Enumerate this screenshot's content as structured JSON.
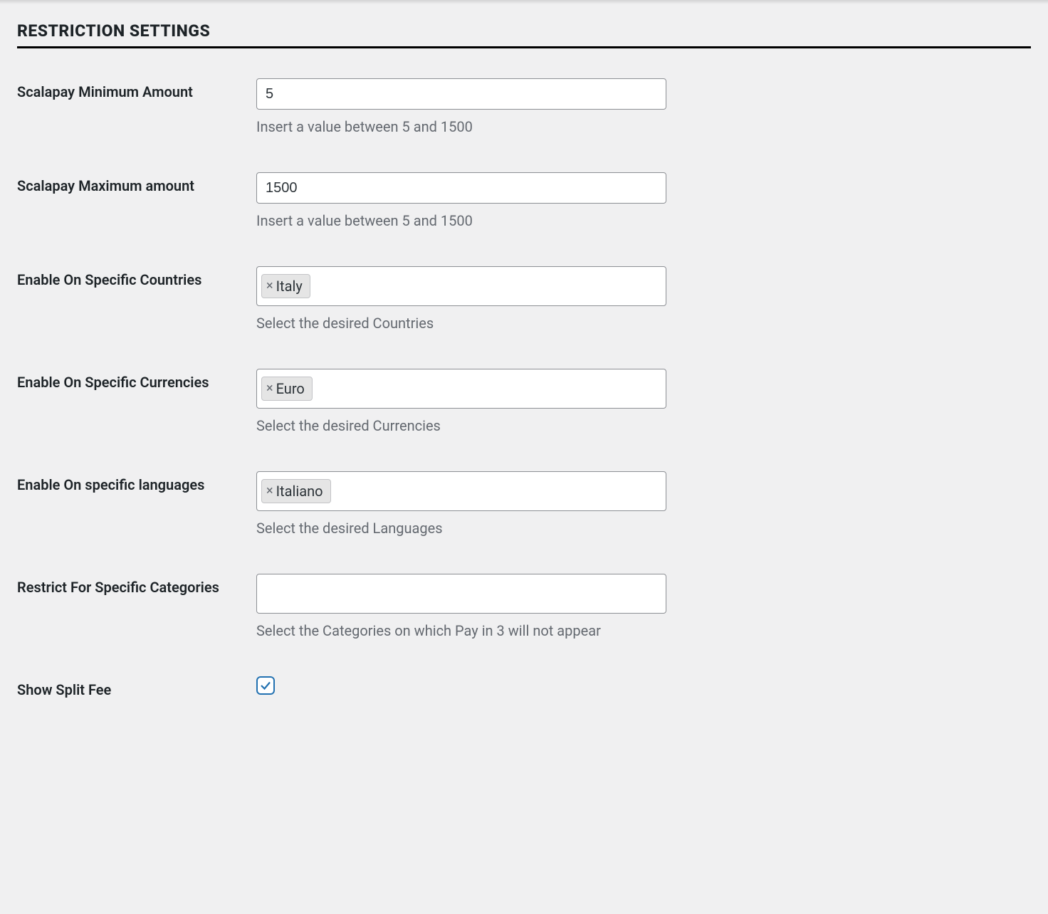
{
  "section": {
    "heading": "RESTRICTION SETTINGS"
  },
  "fields": {
    "min_amount": {
      "label": "Scalapay Minimum Amount",
      "value": "5",
      "description": "Insert a value between 5 and 1500"
    },
    "max_amount": {
      "label": "Scalapay Maximum amount",
      "value": "1500",
      "description": "Insert a value between 5 and 1500"
    },
    "countries": {
      "label": "Enable On Specific Countries",
      "tag": "Italy",
      "description": "Select the desired Countries"
    },
    "currencies": {
      "label": "Enable On Specific Currencies",
      "tag": "Euro",
      "description": "Select the desired Currencies"
    },
    "languages": {
      "label": "Enable On specific languages",
      "tag": "Italiano",
      "description": "Select the desired Languages"
    },
    "categories": {
      "label": "Restrict For Specific Categories",
      "description": "Select the Categories on which Pay in 3 will not appear"
    },
    "split_fee": {
      "label": "Show Split Fee",
      "checked": true
    }
  }
}
